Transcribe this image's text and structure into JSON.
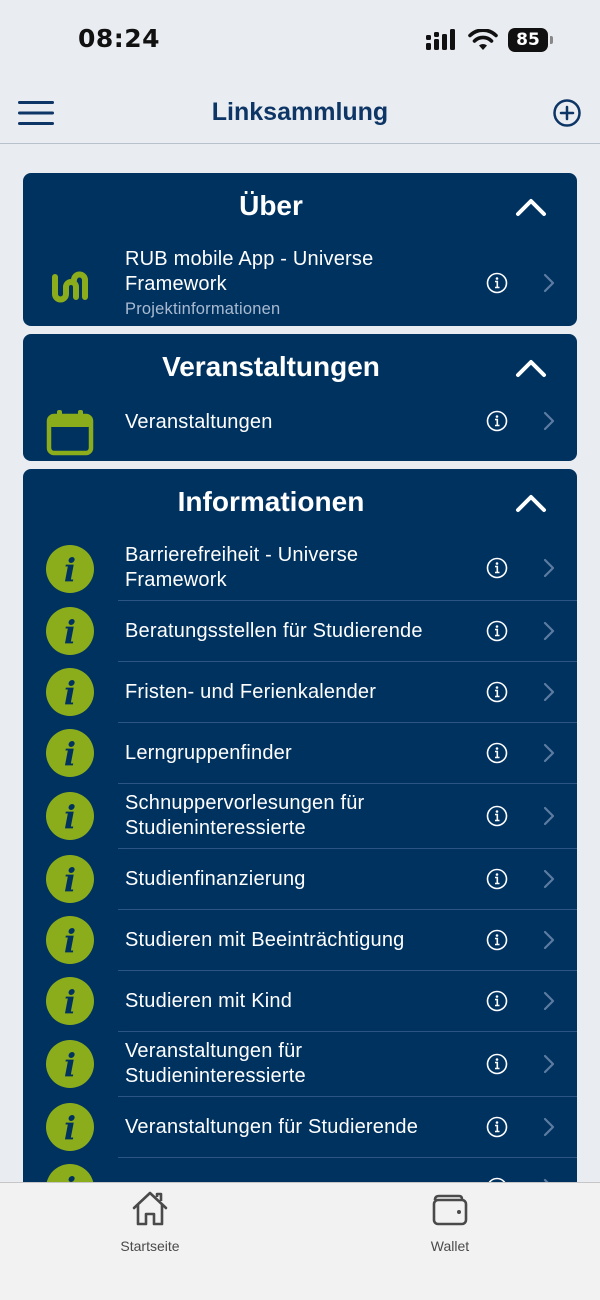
{
  "status_bar": {
    "time": "08:24",
    "battery": "85"
  },
  "header": {
    "title": "Linksammlung"
  },
  "sections": [
    {
      "title": "Über",
      "items": [
        {
          "label": "RUB mobile App - Universe Framework",
          "subtitle": "Projektinformationen",
          "icon": "universe-logo-icon"
        }
      ]
    },
    {
      "title": "Veranstaltungen",
      "items": [
        {
          "label": "Veranstaltungen",
          "icon": "calendar-icon"
        }
      ]
    },
    {
      "title": "Informationen",
      "items": [
        {
          "label": "Barrierefreiheit - Universe Framework",
          "icon": "info-icon"
        },
        {
          "label": "Beratungsstellen für Studierende",
          "icon": "info-icon"
        },
        {
          "label": "Fristen- und Ferienkalender",
          "icon": "info-icon"
        },
        {
          "label": "Lerngruppenfinder",
          "icon": "info-icon"
        },
        {
          "label": "Schnuppervorlesungen für Studieninteressierte",
          "icon": "info-icon"
        },
        {
          "label": "Studienfinanzierung",
          "icon": "info-icon"
        },
        {
          "label": "Studieren mit Beeinträchtigung",
          "icon": "info-icon"
        },
        {
          "label": "Studieren mit Kind",
          "icon": "info-icon"
        },
        {
          "label": "Veranstaltungen für Studieninteressierte",
          "icon": "info-icon"
        },
        {
          "label": "Veranstaltungen für Studierende",
          "icon": "info-icon"
        },
        {
          "label": "",
          "icon": "info-icon"
        }
      ]
    }
  ],
  "tab_bar": {
    "home_label": "Startseite",
    "wallet_label": "Wallet"
  },
  "colors": {
    "accent": "#8cad1b",
    "panel": "#003260",
    "title": "#0d3566"
  }
}
